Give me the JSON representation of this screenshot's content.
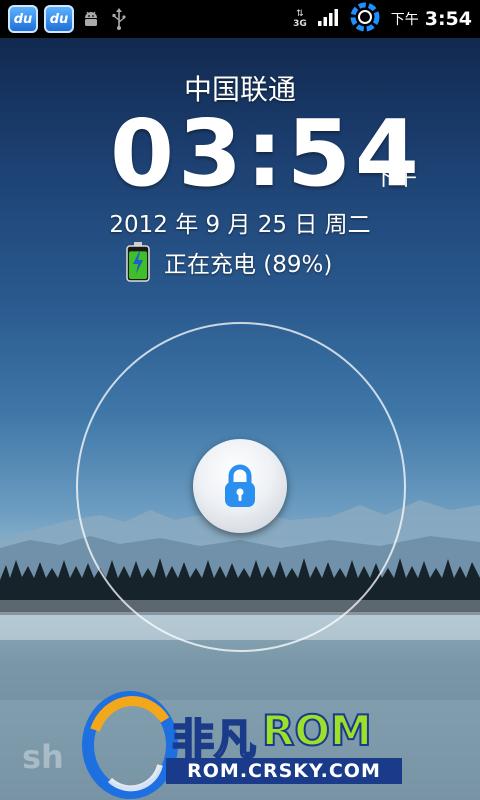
{
  "status_bar": {
    "left_icons": [
      "du-app-icon",
      "du-app-icon",
      "android-debug-icon",
      "usb-icon"
    ],
    "du_label": "du",
    "network_type": "3G",
    "right_icons": [
      "data-arrows-icon",
      "signal-bars-icon",
      "sync-ring-icon"
    ],
    "ampm": "下午",
    "time": "3:54"
  },
  "lockscreen": {
    "carrier": "中国联通",
    "clock": "03:54",
    "ampm": "下午",
    "date": "2012 年 9 月 25 日 周二",
    "charging_text": "正在充电 (89%)",
    "battery_level": 0.89,
    "unlock_icon": "padlock-icon"
  },
  "watermark": {
    "brand": "非凡",
    "brand_rom": "ROM",
    "url": "ROM.CRSKY.COM",
    "faint_text": "sh"
  },
  "colors": {
    "status_bar_bg": "#000000",
    "lock_blue": "#2b8ff0",
    "battery_green": "#3fbf2a"
  }
}
